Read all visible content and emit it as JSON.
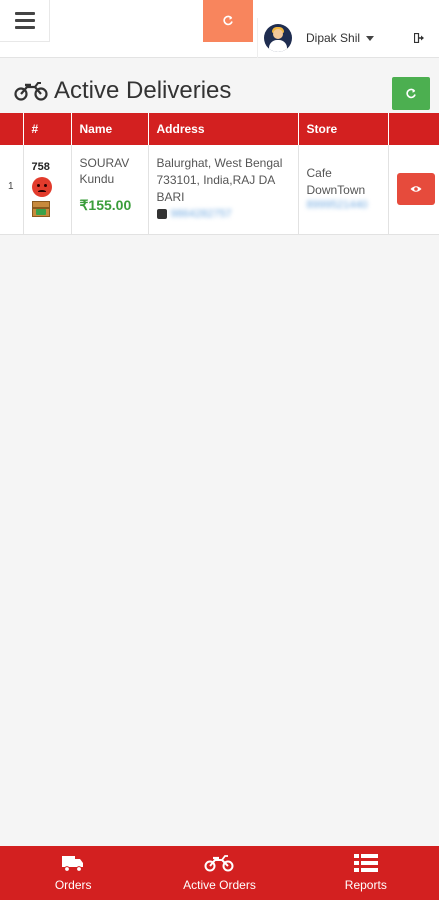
{
  "header": {
    "menu_icon": "hamburger-icon",
    "refresh_icon": "refresh-icon",
    "user_name": "Dipak Shil",
    "logout_icon": "logout-icon",
    "colors": {
      "refresh_bg": "#f8855d",
      "bar_bg": "#ffffff"
    }
  },
  "page": {
    "title": "Active Deliveries",
    "title_icon": "motorcycle-icon",
    "refresh_icon": "refresh-icon",
    "refresh_color": "#4caf50"
  },
  "table": {
    "columns": [
      "",
      "#",
      "Name",
      "Address",
      "Store",
      ""
    ],
    "header_color": "#d32020",
    "rows": [
      {
        "index": "1",
        "order_no": "758",
        "status_icon": "angry-face-icon",
        "package_icon": "package-icon",
        "customer_name": "SOURAV Kundu",
        "amount": "₹155.00",
        "address": "Balurghat, West Bengal 733101, India,RAJ DA BARI",
        "customer_phone": "9864282757",
        "store_name": "Cafe DownTown",
        "store_phone": "8999521440",
        "view_icon": "eye-icon"
      }
    ]
  },
  "bottom_nav": {
    "color": "#d32020",
    "items": [
      {
        "label": "Orders",
        "icon": "truck-icon"
      },
      {
        "label": "Active Orders",
        "icon": "motorcycle-icon"
      },
      {
        "label": "Reports",
        "icon": "list-icon"
      }
    ]
  }
}
